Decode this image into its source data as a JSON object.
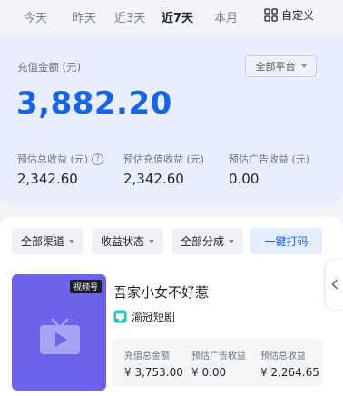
{
  "tabs": [
    {
      "label": "今天",
      "active": false
    },
    {
      "label": "昨天",
      "active": false
    },
    {
      "label": "近3天",
      "active": false
    },
    {
      "label": "近7天",
      "active": true
    },
    {
      "label": "本月",
      "active": false
    }
  ],
  "custom_label": "自定义",
  "summary": {
    "recharge_label": "充值金额 (元)",
    "platform_select": "全部平台",
    "recharge_amount": "3,882.20",
    "estimates": [
      {
        "label": "预估总收益 (元)",
        "value": "2,342.60"
      },
      {
        "label": "预估充值收益 (元)",
        "value": "2,342.60"
      },
      {
        "label": "预估广告收益 (元)",
        "value": "0.00"
      }
    ]
  },
  "filters": {
    "channel": "全部渠道",
    "revenue_status": "收益状态",
    "share": "全部分成",
    "mark_button": "一键打码"
  },
  "item": {
    "poster_tag": "视频号",
    "title": "吾家小女不好惹",
    "producer": "渝冠短剧",
    "stats": [
      {
        "label": "充值总金额",
        "value": "¥ 3,753.00"
      },
      {
        "label": "预估广告收益",
        "value": "¥ 0.00"
      },
      {
        "label": "预估总收益",
        "value": "¥ 2,264.65"
      }
    ]
  },
  "colors": {
    "accent": "#1765e6",
    "summary_bg": "#e8eefb",
    "poster": "#6b63ea",
    "producer_icon": "#19c9b8"
  }
}
